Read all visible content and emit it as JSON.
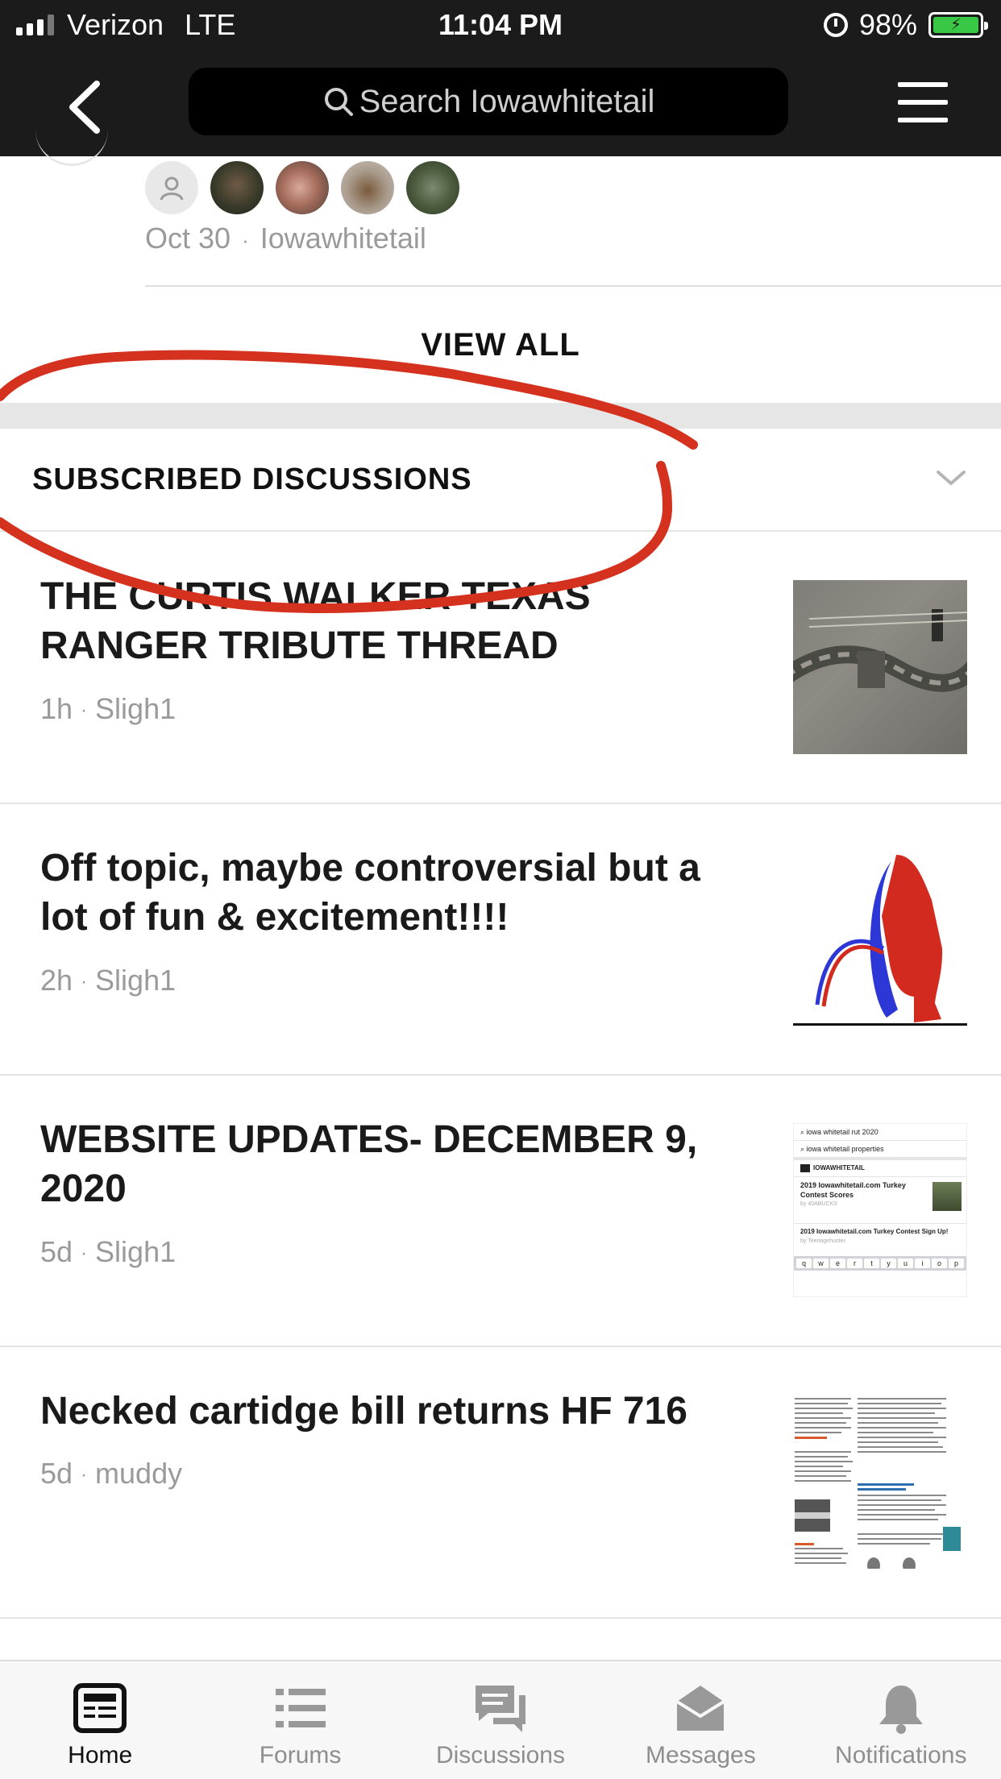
{
  "status_bar": {
    "carrier": "Verizon",
    "network": "LTE",
    "time": "11:04 PM",
    "battery": "98%"
  },
  "top_nav": {
    "search_placeholder": "Search Iowawhitetail"
  },
  "previous_item": {
    "date": "Oct 30",
    "author": "Iowawhitetail"
  },
  "view_all_label": "VIEW ALL",
  "section": {
    "title": "SUBSCRIBED DISCUSSIONS"
  },
  "threads": [
    {
      "title": "THE CURTIS WALKER TEXAS RANGER TRIBUTE THREAD",
      "age": "1h",
      "author": "Sligh1"
    },
    {
      "title": "Off topic, maybe controversial but a lot of fun & excitement!!!!",
      "age": "2h",
      "author": "Sligh1"
    },
    {
      "title": "WEBSITE UPDATES- DECEMBER 9, 2020",
      "age": "5d",
      "author": "Sligh1"
    },
    {
      "title": "Necked cartidge bill returns HF 716",
      "age": "5d",
      "author": "muddy"
    }
  ],
  "thumb_web": {
    "search1": "iowa whitetail rut 2020",
    "search2": "iowa whitetail properties",
    "brand": "IOWAWHITETAIL",
    "post1": "2019 Iowawhitetail.com Turkey Contest Scores",
    "post1_by": "by 40ABUCKS",
    "post2": "2019 Iowawhitetail.com Turkey Contest Sign Up!",
    "post2_by": "by Teenagehunter",
    "keys": [
      "q",
      "w",
      "e",
      "r",
      "t",
      "y",
      "u",
      "i",
      "o",
      "p"
    ]
  },
  "tabs": [
    {
      "label": "Home",
      "icon": "home-icon"
    },
    {
      "label": "Forums",
      "icon": "list-icon"
    },
    {
      "label": "Discussions",
      "icon": "chat-bubbles-icon"
    },
    {
      "label": "Messages",
      "icon": "envelope-icon"
    },
    {
      "label": "Notifications",
      "icon": "bell-icon"
    }
  ],
  "colors": {
    "nav_bg": "#1b1b1b",
    "annotation_red": "#d4321f",
    "battery_green": "#39c845",
    "meta_gray": "#9a9a9a"
  }
}
